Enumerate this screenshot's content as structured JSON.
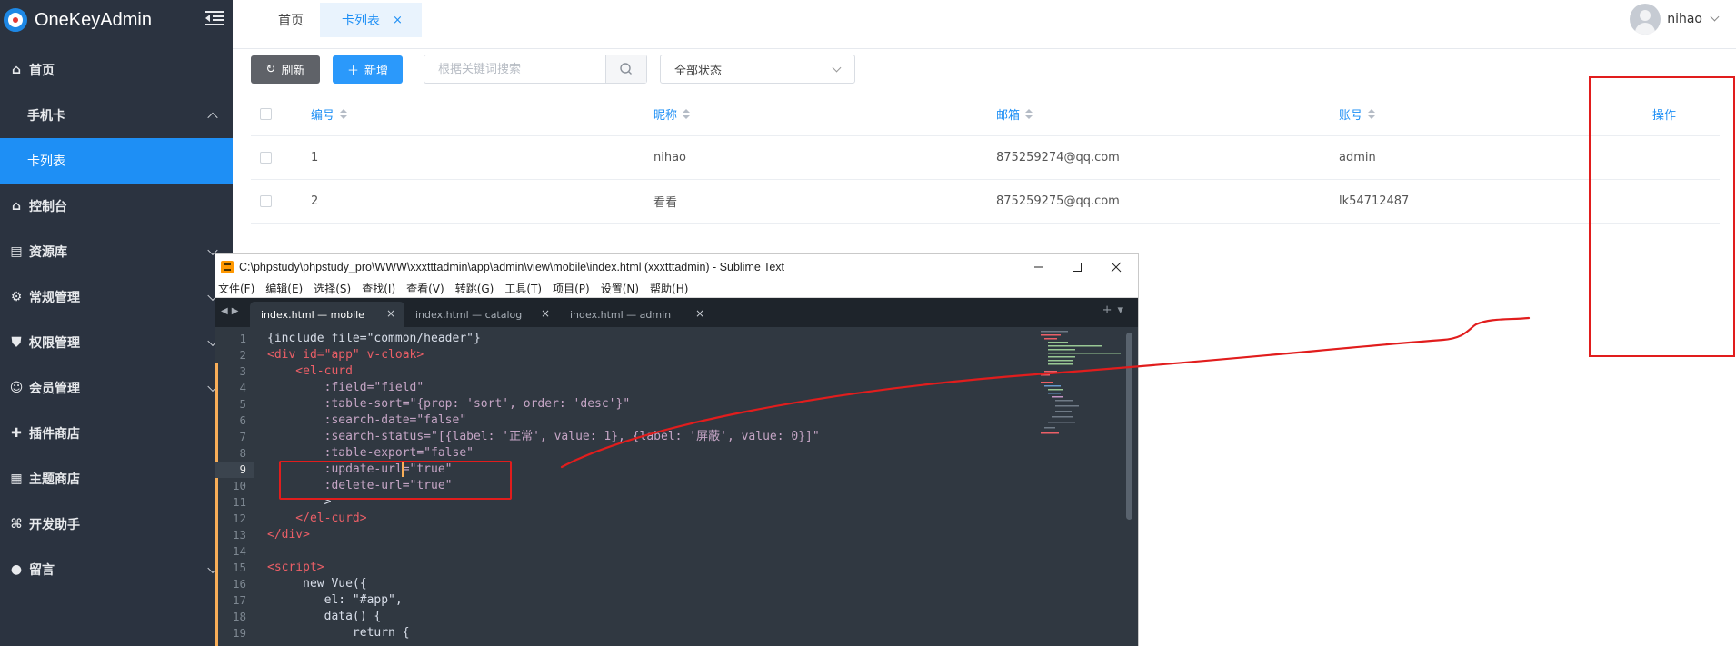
{
  "sidebar": {
    "logo_text": "OneKeyAdmin",
    "items": [
      {
        "label": "首页",
        "icon": "home-icon"
      },
      {
        "label": "手机卡",
        "icon": "",
        "sub": true
      },
      {
        "label": "卡列表",
        "icon": "",
        "sub": true,
        "active": true
      },
      {
        "label": "控制台",
        "icon": "home-icon"
      },
      {
        "label": "资源库",
        "icon": "stack-icon"
      },
      {
        "label": "常规管理",
        "icon": "gear-icon"
      },
      {
        "label": "权限管理",
        "icon": "shield-icon"
      },
      {
        "label": "会员管理",
        "icon": "user-gear-icon"
      },
      {
        "label": "插件商店",
        "icon": "puzzle-icon"
      },
      {
        "label": "主题商店",
        "icon": "table-icon"
      },
      {
        "label": "开发助手",
        "icon": "code-icon"
      },
      {
        "label": "留言",
        "icon": "chat-icon"
      }
    ]
  },
  "topbar": {
    "tabs": [
      {
        "label": "首页"
      },
      {
        "label": "卡列表",
        "close": "×"
      }
    ],
    "username": "nihao"
  },
  "toolbar": {
    "refresh_label": "刷新",
    "add_label": "新增",
    "search_placeholder": "根据关键词搜索",
    "status_value": "全部状态"
  },
  "table": {
    "headers": [
      "编号",
      "昵称",
      "邮箱",
      "账号",
      "操作"
    ],
    "rows": [
      [
        "1",
        "nihao",
        "875259274@qq.com",
        "admin"
      ],
      [
        "2",
        "看看",
        "875259275@qq.com",
        "lk54712487"
      ]
    ]
  },
  "editor": {
    "title": "C:\\phpstudy\\phpstudy_pro\\WWW\\xxxtttadmin\\app\\admin\\view\\mobile\\index.html (xxxtttadmin) - Sublime Text",
    "menu": [
      "文件(F)",
      "编辑(E)",
      "选择(S)",
      "查找(I)",
      "查看(V)",
      "转跳(G)",
      "工具(T)",
      "项目(P)",
      "设置(N)",
      "帮助(H)"
    ],
    "tabs": [
      "index.html — mobile",
      "index.html — catalog",
      "index.html — admin"
    ],
    "line_numbers": [
      "1",
      "2",
      "3",
      "4",
      "5",
      "6",
      "7",
      "8",
      "9",
      "10",
      "11",
      "12",
      "13",
      "14",
      "15",
      "16",
      "17",
      "18",
      "19"
    ],
    "current_line": "9",
    "code": [
      "{include file=\"common/header\"}",
      "<div id=\"app\" v-cloak>",
      "    <el-curd",
      "        :field=\"field\"",
      "        :table-sort=\"{prop: 'sort', order: 'desc'}\"",
      "        :search-date=\"false\"",
      "        :search-status=\"[{label: '正常', value: 1}, {label: '屏蔽', value: 0}]\"",
      "        :table-export=\"false\"",
      "        :update-url=\"true\"",
      "        :delete-url=\"true\"",
      "        >",
      "    </el-curd>",
      "</div>",
      "",
      "<script>",
      "     new Vue({",
      "        el: \"#app\",",
      "        data() {",
      "            return {"
    ]
  },
  "colors": {
    "accent": "#1e8ff5",
    "sidebar_bg": "#2b3340",
    "annotation": "#e11d1d"
  }
}
